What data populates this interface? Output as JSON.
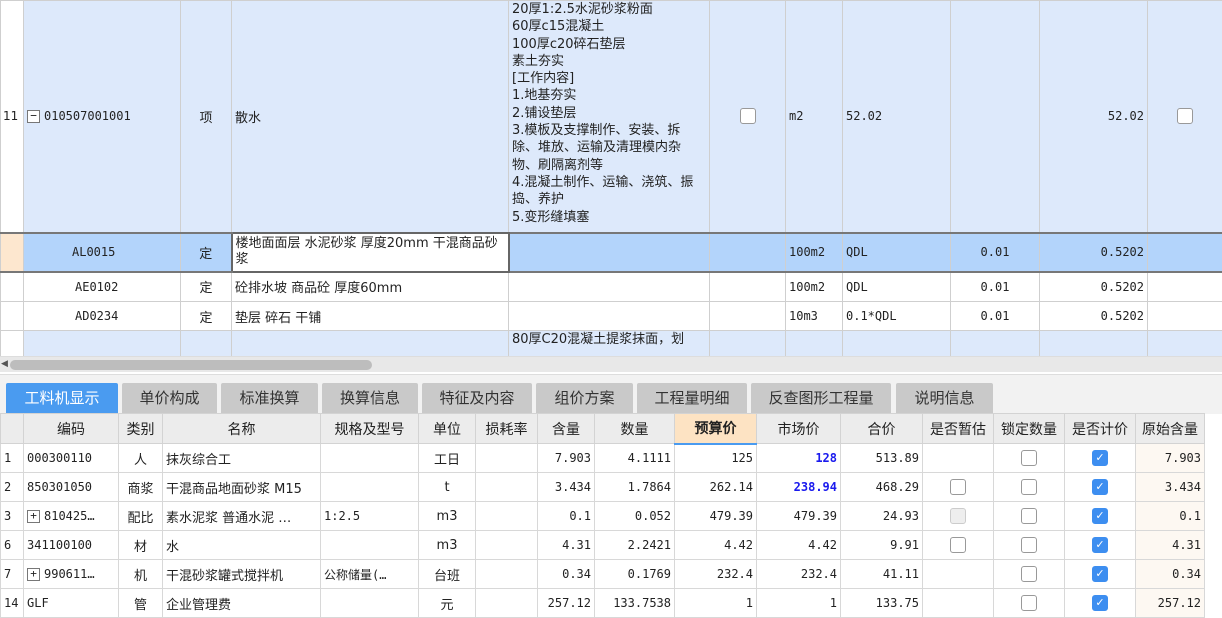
{
  "top_rows": [
    {
      "rownum": "11",
      "code": "010507001001",
      "type": "项",
      "name": "散水",
      "features": [
        "20厚1:2.5水泥砂浆粉面",
        "60厚c15混凝土",
        "100厚c20碎石垫层",
        "素土夯实",
        "[工作内容]",
        "1.地基夯实",
        "2.铺设垫层",
        "3.模板及支撑制作、安装、拆除、堆放、运输及清理模内杂物、刷隔离剂等",
        "4.混凝土制作、运输、浇筑、振捣、养护",
        "5.变形缝填塞"
      ],
      "unit": "m2",
      "expr": "52.02",
      "coef": "",
      "qty": "52.02"
    },
    {
      "rownum": "",
      "code": "AL0015",
      "type": "定",
      "name": "楼地面面层 水泥砂浆 厚度20mm 干混商品砂浆",
      "unit": "100m2",
      "expr": "QDL",
      "coef": "0.01",
      "qty": "0.5202"
    },
    {
      "rownum": "",
      "code": "AE0102",
      "type": "定",
      "name": "砼排水坡 商品砼 厚度60mm",
      "unit": "100m2",
      "expr": "QDL",
      "coef": "0.01",
      "qty": "0.5202"
    },
    {
      "rownum": "",
      "code": "AD0234",
      "type": "定",
      "name": "垫层 碎石 干铺",
      "unit": "10m3",
      "expr": "0.1*QDL",
      "coef": "0.01",
      "qty": "0.5202"
    },
    {
      "features_partial": "80厚C20混凝土提浆抹面，划"
    }
  ],
  "tabs": [
    "工料机显示",
    "单价构成",
    "标准换算",
    "换算信息",
    "特征及内容",
    "组价方案",
    "工程量明细",
    "反查图形工程量",
    "说明信息"
  ],
  "columns": [
    "编码",
    "类别",
    "名称",
    "规格及型号",
    "单位",
    "损耗率",
    "含量",
    "数量",
    "预算价",
    "市场价",
    "合价",
    "是否暂估",
    "锁定数量",
    "是否计价",
    "原始含量"
  ],
  "rows": [
    {
      "n": "1",
      "code": "000300110",
      "cat": "人",
      "name": "抹灰综合工",
      "spec": "",
      "unit": "工日",
      "loss": "",
      "content": "7.903",
      "qty": "4.1111",
      "budget": "125",
      "market": "128",
      "total": "513.89",
      "orig": "7.903"
    },
    {
      "n": "2",
      "code": "850301050",
      "cat": "商浆",
      "name": "干混商品地面砂浆 M15",
      "spec": "",
      "unit": "t",
      "loss": "",
      "content": "3.434",
      "qty": "1.7864",
      "budget": "262.14",
      "market": "238.94",
      "total": "468.29",
      "orig": "3.434"
    },
    {
      "n": "3",
      "code": "810425…",
      "cat": "配比",
      "name": "素水泥浆 普通水泥 …",
      "spec": "1:2.5",
      "unit": "m3",
      "loss": "",
      "content": "0.1",
      "qty": "0.052",
      "budget": "479.39",
      "market": "479.39",
      "total": "24.93",
      "orig": "0.1"
    },
    {
      "n": "6",
      "code": "341100100",
      "cat": "材",
      "name": "水",
      "spec": "",
      "unit": "m3",
      "loss": "",
      "content": "4.31",
      "qty": "2.2421",
      "budget": "4.42",
      "market": "4.42",
      "total": "9.91",
      "orig": "4.31"
    },
    {
      "n": "7",
      "code": "990611…",
      "cat": "机",
      "name": "干混砂浆罐式搅拌机",
      "spec": "公称储量(…",
      "unit": "台班",
      "loss": "",
      "content": "0.34",
      "qty": "0.1769",
      "budget": "232.4",
      "market": "232.4",
      "total": "41.11",
      "orig": "0.34"
    },
    {
      "n": "14",
      "code": "GLF",
      "cat": "管",
      "name": "企业管理费",
      "spec": "",
      "unit": "元",
      "loss": "",
      "content": "257.12",
      "qty": "133.7538",
      "budget": "1",
      "market": "1",
      "total": "133.75",
      "orig": "257.12"
    }
  ]
}
